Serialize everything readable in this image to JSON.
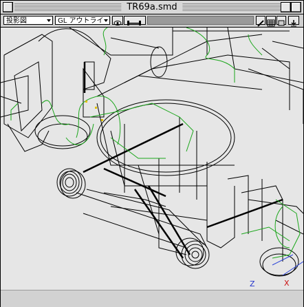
{
  "window": {
    "title": "TR69a.smd"
  },
  "toolbar": {
    "view_select": "投影図",
    "render_select": "GL アウトライン",
    "icons": [
      "eye-icon",
      "dumbbell-icon",
      "pencil-icon",
      "grid-icon",
      "panel-icon",
      "download-icon"
    ]
  },
  "viewport": {
    "axis_z": "Z",
    "axis_x": "X",
    "colors": {
      "background": "#e6e6e6",
      "wire": "#000000",
      "green_wire": "#1aa61a",
      "blue_wire": "#2a44d8",
      "axis_x": "#cc1111",
      "axis_z": "#2233cc"
    }
  }
}
